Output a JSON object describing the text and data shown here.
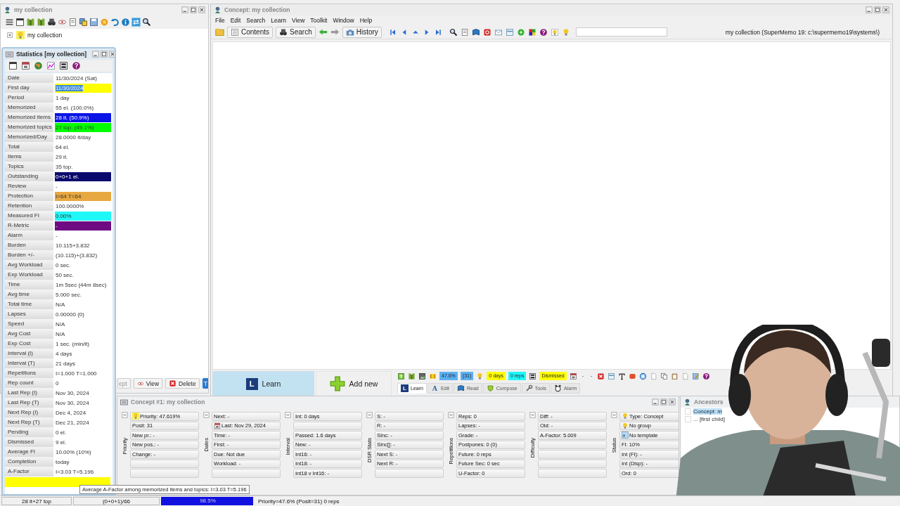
{
  "collection_window": {
    "title": "my collection",
    "tree": [
      {
        "label": "my collection",
        "expanded": false
      }
    ],
    "buttons": [
      {
        "label": "ept",
        "kind": "plain"
      },
      {
        "label": "View",
        "kind": "view"
      },
      {
        "label": "Delete",
        "kind": "delete"
      },
      {
        "label": "T",
        "kind": "tab"
      }
    ]
  },
  "statistics": {
    "title": "Statistics [my collection]",
    "rows": [
      {
        "label": "Date",
        "value": "11/30/2024 (Sat)",
        "selected": false
      },
      {
        "label": "First day",
        "value": "11/30/2024",
        "color": "#ffff00",
        "selected": true
      },
      {
        "label": "Period",
        "value": "1 day",
        "selected": false
      },
      {
        "label": "Memorized",
        "value": "55 el. (100.0%)",
        "selected": false
      },
      {
        "label": "Memorized items",
        "value": "28 it. (50.9%)",
        "color": "#0a14e6",
        "selected": false
      },
      {
        "label": "Memorized topics",
        "value": "27 top. (49.1%)",
        "color": "#00ff00",
        "selected": false
      },
      {
        "label": "Memorized/Day",
        "value": "28.0000 it/day",
        "selected": false
      },
      {
        "label": "Total",
        "value": "64 el.",
        "selected": false
      },
      {
        "label": "Items",
        "value": "29 it.",
        "selected": false
      },
      {
        "label": "Topics",
        "value": "35 top.",
        "selected": false
      },
      {
        "label": "Outstanding",
        "value": "0+0+1 el.",
        "color": "#0a0a6e",
        "selected": false
      },
      {
        "label": "Review",
        "value": "-",
        "selected": false
      },
      {
        "label": "Protection",
        "value": "I=64 T=64",
        "color": "#e8a840",
        "selected": false
      },
      {
        "label": "Retention",
        "value": "100.0000%",
        "selected": false
      },
      {
        "label": "Measured FI",
        "value": "0.00%",
        "color": "#20f8f8",
        "selected": false
      },
      {
        "label": "R-Metric",
        "value": "-",
        "color": "#6e0a82",
        "selected": false
      },
      {
        "label": "Alarm",
        "value": "-",
        "selected": false
      },
      {
        "label": "Burden",
        "value": "10.115+3.832",
        "selected": false
      },
      {
        "label": "Burden +/-",
        "value": "(10.115)+(3.832)",
        "selected": false
      },
      {
        "label": "Avg Workload",
        "value": "0 sec.",
        "selected": false
      },
      {
        "label": "Exp Workload",
        "value": "50 sec.",
        "selected": false
      },
      {
        "label": "Time",
        "value": "1m 5sec (44m 8sec)",
        "selected": false
      },
      {
        "label": "Avg time",
        "value": "5.000 sec.",
        "selected": false
      },
      {
        "label": "Total time",
        "value": "N/A",
        "selected": false
      },
      {
        "label": "Lapses",
        "value": "0.00000 (0)",
        "selected": false
      },
      {
        "label": "Speed",
        "value": "N/A",
        "selected": false
      },
      {
        "label": "Avg Cost",
        "value": "N/A",
        "selected": false
      },
      {
        "label": "Exp Cost",
        "value": "1 sec. (min/it)",
        "selected": false
      },
      {
        "label": "Interval (I)",
        "value": "4 days",
        "selected": false
      },
      {
        "label": "Interval (T)",
        "value": "21 days",
        "selected": false
      },
      {
        "label": "Repetitions",
        "value": "I=1.000 T=1.000",
        "selected": false
      },
      {
        "label": "Rep count",
        "value": "0",
        "selected": false
      },
      {
        "label": "Last Rep (I)",
        "value": "Nov 30, 2024",
        "selected": false
      },
      {
        "label": "Last Rep (T)",
        "value": "Nov 30, 2024",
        "selected": false
      },
      {
        "label": "Next Rep (I)",
        "value": "Dec 4, 2024",
        "selected": false
      },
      {
        "label": "Next Rep (T)",
        "value": "Dec 21, 2024",
        "selected": false
      },
      {
        "label": "Pending",
        "value": "0 el.",
        "selected": false
      },
      {
        "label": "Dismissed",
        "value": "9 el.",
        "selected": false
      },
      {
        "label": "Average FI",
        "value": "10.00% (10%)",
        "selected": false
      },
      {
        "label": "Completion",
        "value": "today",
        "selected": false
      },
      {
        "label": "A-Factor",
        "value": "I=3.03 T=5.196",
        "selected": false
      }
    ],
    "summary_bar": {
      "color": "#ffff00"
    },
    "tooltip": "Average A-Factor among memorized items and topics: I=3.03 T=5.196"
  },
  "main_window": {
    "title": "Concept: my collection",
    "menu": [
      "File",
      "Edit",
      "Search",
      "Learn",
      "View",
      "Toolkit",
      "Window",
      "Help"
    ],
    "toolbar_buttons": [
      {
        "label": "Contents",
        "kind": "contents"
      },
      {
        "label": "Search",
        "kind": "search"
      },
      {
        "label": "History",
        "kind": "history"
      }
    ],
    "path": "my collection (SuperMemo 19: c:\\supermemo19\\systems\\)",
    "learn_buttons": [
      {
        "label": "Learn",
        "kind": "learn",
        "glyph": "L"
      },
      {
        "label": "Add new",
        "kind": "add"
      }
    ],
    "chips": [
      {
        "label": "47.6%",
        "color": "#5cb0f0"
      },
      {
        "label": "(31)",
        "color": "#5cb0f0"
      },
      {
        "label": "0 days",
        "color": "#ffff00"
      },
      {
        "label": "0 reps",
        "color": "#20f8f8"
      },
      {
        "label": "Dismissed",
        "color": "#ffff00"
      },
      {
        "label": "-"
      },
      {
        "label": "-"
      }
    ],
    "tabs": [
      {
        "label": "Learn",
        "kind": "learn",
        "glyph": "L",
        "selected": true
      },
      {
        "label": "Edit",
        "kind": "edit",
        "glyph": "A",
        "selected": false
      },
      {
        "label": "Read",
        "kind": "read",
        "selected": false
      },
      {
        "label": "Compose",
        "kind": "compose",
        "selected": false
      },
      {
        "label": "Tools",
        "kind": "tools",
        "selected": false
      },
      {
        "label": "Alarm",
        "kind": "alarm",
        "selected": false
      }
    ]
  },
  "element_window": {
    "title": "Concept #1: my collection",
    "groups": [
      {
        "title": "Priority",
        "fields": [
          "Priority: 47.619%",
          "Posit: 31",
          "New pr.: -",
          "New pos.: -",
          "Change: -"
        ]
      },
      {
        "title": "Dates",
        "fields": [
          "Next: -",
          "Last: Nov 29, 2024",
          "Time: -",
          "First: -",
          "Due: Not due",
          "Workload: -"
        ]
      },
      {
        "title": "Interval",
        "fields": [
          "Int: 0 days",
          "Passed: 1.6 days",
          "New: -",
          "Int16: -",
          "Int18: -",
          "Int18 v Int16: -"
        ]
      },
      {
        "title": "DSR Stats",
        "fields": [
          "S: -",
          "R: -",
          "SInc: -",
          "SInc[]: -",
          "Next S: -",
          "Next R: -"
        ]
      },
      {
        "title": "Repetitions",
        "fields": [
          "Reps: 0",
          "Lapses: -",
          "Grade: -",
          "Postpones: 0 (0)",
          "Future: 0 reps",
          "Future Sec: 0 sec",
          "U-Factor: 0"
        ]
      },
      {
        "title": "Difficulty",
        "fields": [
          "Diff: -",
          "Old: -",
          "A-Factor: 5.009"
        ]
      },
      {
        "title": "Status",
        "fields": [
          "Type: Concept",
          "No group",
          "No template",
          "FI: 10%",
          "Int (FI): -",
          "Int (Disp): -",
          "Ord: 0"
        ]
      }
    ]
  },
  "ancestors_window": {
    "title": "Ancestors",
    "items": [
      {
        "label": "Concept: m",
        "selected": true,
        "checked": false
      },
      {
        "label": "... [first child]",
        "selected": false,
        "checked": false
      }
    ]
  },
  "status_bar": {
    "items": "28 it+27 top",
    "outstanding": "(0+0+1)/66",
    "progress": {
      "level": 0.985,
      "reading": "98.5%"
    },
    "info": "Priority=47.6% (Posit=31) 0 reps"
  }
}
